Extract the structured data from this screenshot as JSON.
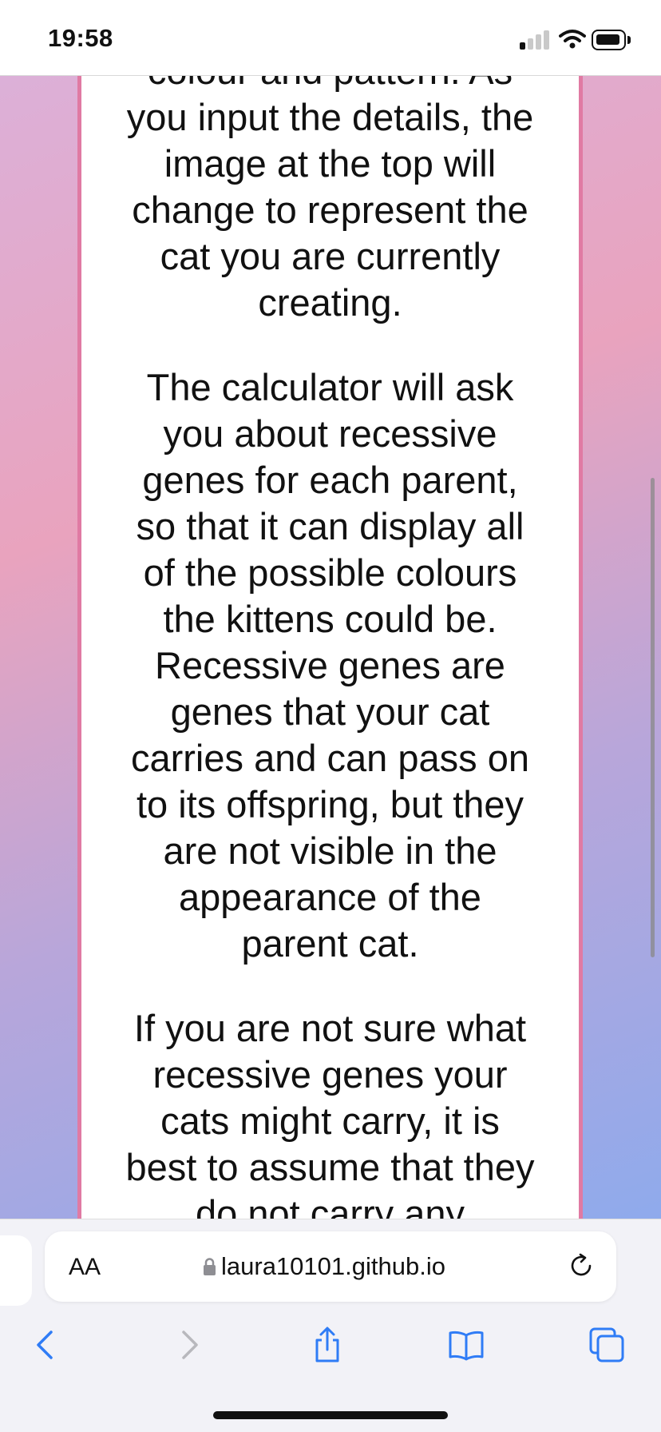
{
  "status_bar": {
    "time": "19:58",
    "signal_icon": "cellular-signal-icon",
    "wifi_icon": "wifi-icon",
    "battery_icon": "battery-icon"
  },
  "article": {
    "paragraphs": [
      "colour and pattern. As you input the details, the image at the top will change to represent the cat you are currently creating.",
      "The calculator will ask you about recessive genes for each parent, so that it can display all of the possible colours the kittens could be. Recessive genes are genes that your cat carries and can pass on to its offspring, but they are not visible in the appearance of the parent cat.",
      "If you are not sure what recessive genes your cats might carry, it is best to assume that they do not carry any"
    ]
  },
  "browser": {
    "aa_label": "AA",
    "url": "laura10101.github.io",
    "lock_icon": "lock-icon",
    "reload_icon": "reload-icon",
    "toolbar_icons": [
      "back-icon",
      "forward-icon",
      "share-icon",
      "bookmarks-icon",
      "tabs-icon"
    ]
  },
  "colors": {
    "card_border": "#e07aa3",
    "accent_blue": "#2f7cf6",
    "disabled_gray": "#b8b8bd"
  }
}
